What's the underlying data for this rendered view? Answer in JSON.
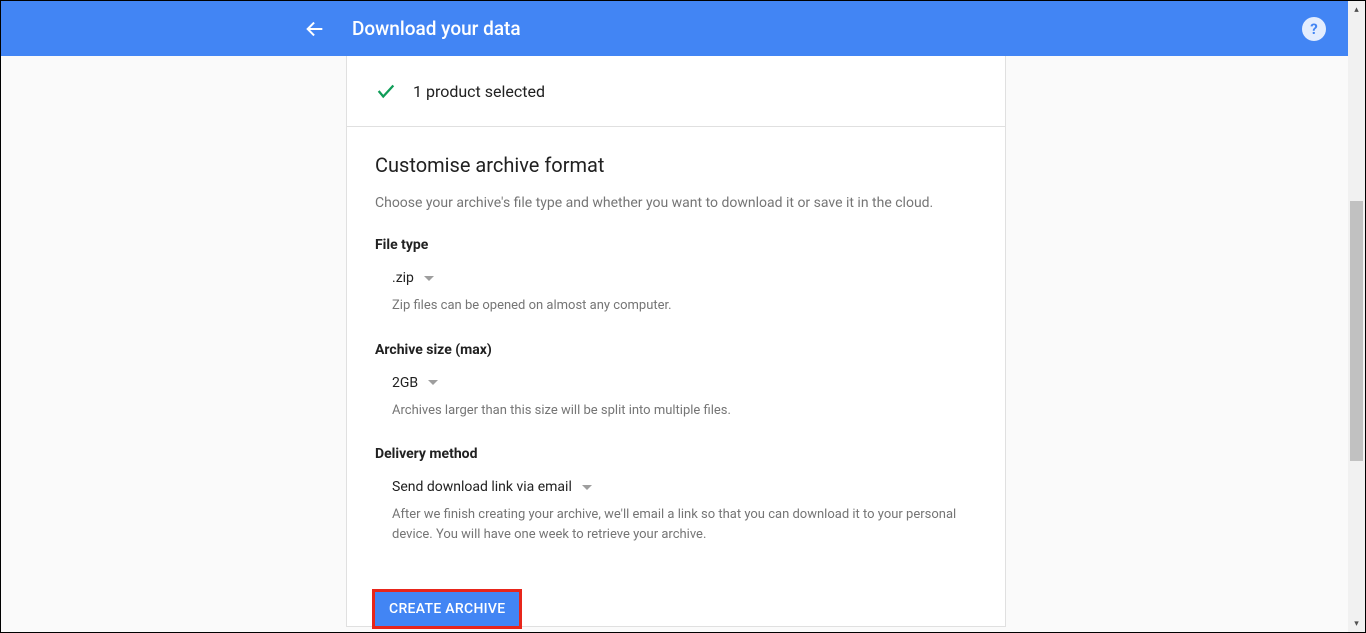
{
  "header": {
    "title": "Download your data"
  },
  "summary": {
    "text": "1 product selected"
  },
  "section": {
    "title": "Customise archive format",
    "description": "Choose your archive's file type and whether you want to download it or save it in the cloud."
  },
  "file_type": {
    "label": "File type",
    "value": ".zip",
    "help": "Zip files can be opened on almost any computer."
  },
  "archive_size": {
    "label": "Archive size (max)",
    "value": "2GB",
    "help": "Archives larger than this size will be split into multiple files."
  },
  "delivery": {
    "label": "Delivery method",
    "value": "Send download link via email",
    "help": "After we finish creating your archive, we'll email a link so that you can download it to your personal device. You will have one week to retrieve your archive."
  },
  "button": {
    "create": "CREATE ARCHIVE"
  }
}
